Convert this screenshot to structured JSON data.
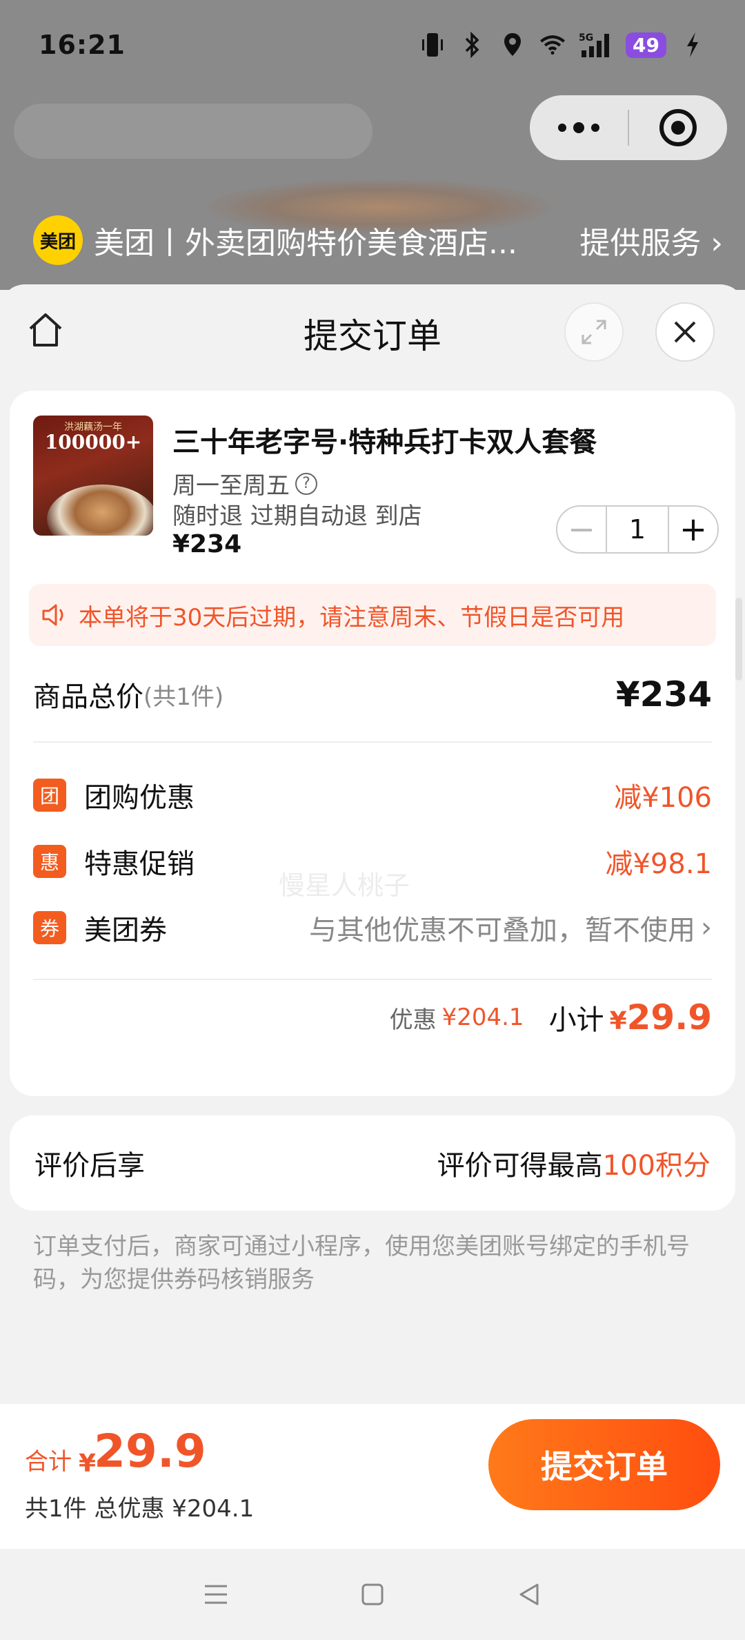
{
  "status_bar": {
    "time": "16:21",
    "battery": "49",
    "network": "5G"
  },
  "provider": {
    "logo_text": "美团",
    "name": "美团丨外卖团购特价美食酒店...",
    "service_link": "提供服务"
  },
  "sheet": {
    "title": "提交订单"
  },
  "product": {
    "thumb_top": "洪湖藕汤一年",
    "thumb_count": "100000+",
    "title": "三十年老字号·特种兵打卡双人套餐",
    "availability": "周一至周五",
    "policy": "随时退 过期自动退 到店",
    "price": "¥234",
    "quantity": "1"
  },
  "notice": {
    "text": "本单将于30天后过期，请注意周末、节假日是否可用"
  },
  "summary": {
    "total_label": "商品总价",
    "total_count": "(共1件)",
    "total_amount": "¥234",
    "watermark": "慢星人桃子",
    "discounts": [
      {
        "badge": "团",
        "label": "团购优惠",
        "value": "减¥106"
      },
      {
        "badge": "惠",
        "label": "特惠促销",
        "value": "减¥98.1"
      },
      {
        "badge": "券",
        "label": "美团券",
        "hint": "与其他优惠不可叠加，暂不使用"
      }
    ],
    "discount_label": "优惠",
    "discount_value": "¥204.1",
    "subtotal_label": "小计",
    "subtotal_currency": "¥",
    "subtotal_value": "29.9"
  },
  "review": {
    "label": "评价后享",
    "text_prefix": "评价可得最高",
    "points": "100积分"
  },
  "tip": "订单支付后，商家可通过小程序，使用您美团账号绑定的手机号码，为您提供券码核销服务",
  "footer": {
    "sum_label": "合计",
    "currency": "¥",
    "sum_value": "29.9",
    "sub_text": "共1件 总优惠 ¥204.1",
    "submit_label": "提交订单"
  },
  "colors": {
    "accent": "#f0552a",
    "brand_yellow": "#ffd100",
    "button_start": "#ff7a1a",
    "button_end": "#ff4d0f"
  },
  "icons": [
    "vibrate-icon",
    "bluetooth-icon",
    "location-icon",
    "wifi-icon",
    "signal-icon",
    "charging-icon",
    "more-icon",
    "target-icon",
    "home-icon",
    "expand-icon",
    "close-icon",
    "help-icon",
    "speaker-icon",
    "chevron-right-icon",
    "menu-icon",
    "square-icon",
    "back-icon"
  ]
}
